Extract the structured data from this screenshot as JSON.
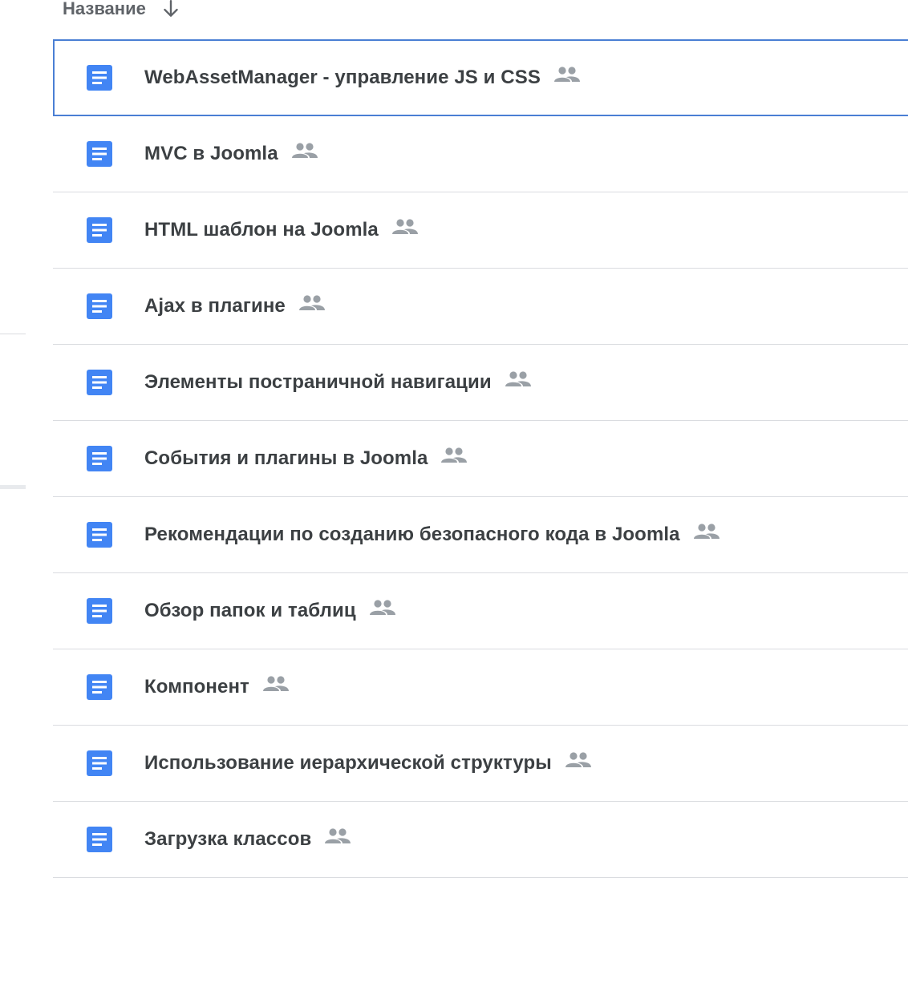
{
  "header": {
    "sort_label": "Название",
    "sort_direction_icon": "arrow-down-icon"
  },
  "colors": {
    "doc_icon": "#4285f4",
    "shared_icon": "#9aa0a6",
    "selection_border": "#4a7fd4",
    "divider": "#dadce0",
    "text": "#3c4043"
  },
  "files": [
    {
      "name": "WebAssetManager - управление JS и CSS",
      "type_icon": "google-doc-icon",
      "shared_icon": "people-icon",
      "selected": true
    },
    {
      "name": "MVC в Joomla",
      "type_icon": "google-doc-icon",
      "shared_icon": "people-icon",
      "selected": false
    },
    {
      "name": "HTML шаблон на Joomla",
      "type_icon": "google-doc-icon",
      "shared_icon": "people-icon",
      "selected": false
    },
    {
      "name": "Ajax в плагине",
      "type_icon": "google-doc-icon",
      "shared_icon": "people-icon",
      "selected": false
    },
    {
      "name": "Элементы постраничной навигации",
      "type_icon": "google-doc-icon",
      "shared_icon": "people-icon",
      "selected": false
    },
    {
      "name": "События и плагины в Joomla",
      "type_icon": "google-doc-icon",
      "shared_icon": "people-icon",
      "selected": false
    },
    {
      "name": "Рекомендации по созданию безопасного кода в Joomla",
      "type_icon": "google-doc-icon",
      "shared_icon": "people-icon",
      "selected": false
    },
    {
      "name": "Обзор папок и таблиц",
      "type_icon": "google-doc-icon",
      "shared_icon": "people-icon",
      "selected": false
    },
    {
      "name": "Компонент",
      "type_icon": "google-doc-icon",
      "shared_icon": "people-icon",
      "selected": false
    },
    {
      "name": "Использование иерархической структуры",
      "type_icon": "google-doc-icon",
      "shared_icon": "people-icon",
      "selected": false
    },
    {
      "name": "Загрузка классов",
      "type_icon": "google-doc-icon",
      "shared_icon": "people-icon",
      "selected": false
    }
  ]
}
